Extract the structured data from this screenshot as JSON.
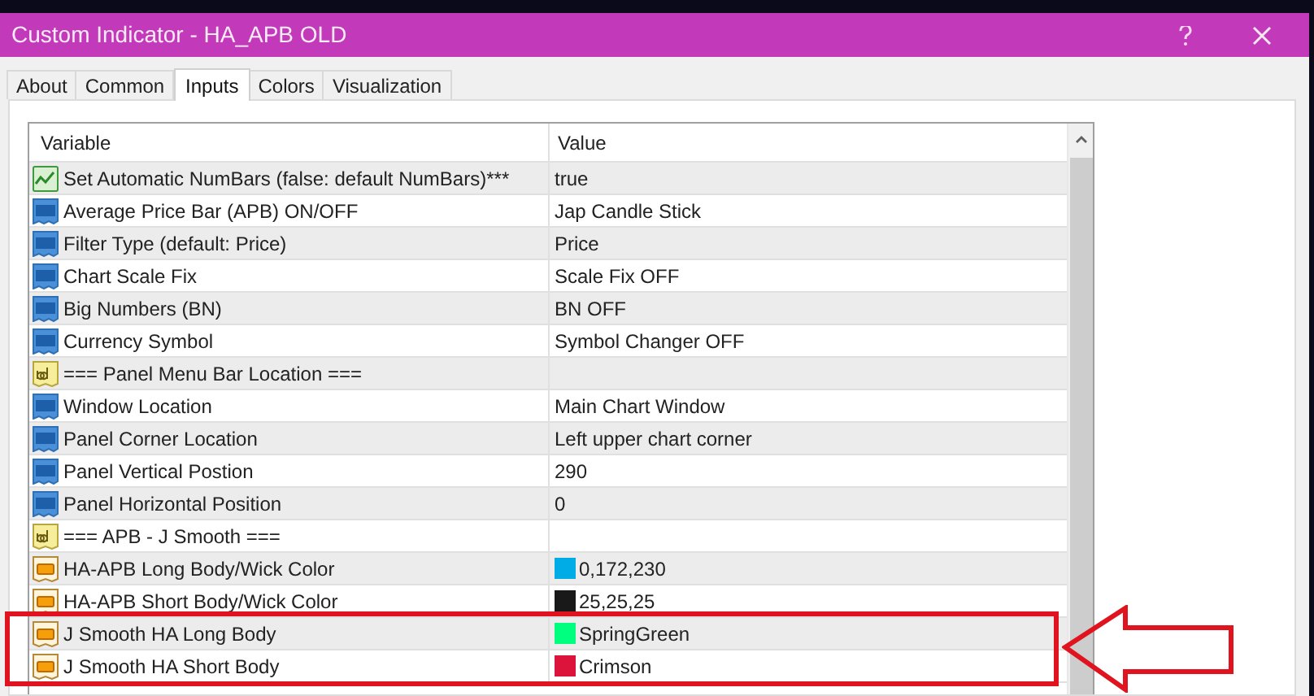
{
  "window": {
    "title": "Custom Indicator - HA_APB OLD"
  },
  "tabs": [
    {
      "label": "About",
      "selected": false
    },
    {
      "label": "Common",
      "selected": false
    },
    {
      "label": "Inputs",
      "selected": true
    },
    {
      "label": "Colors",
      "selected": false
    },
    {
      "label": "Visualization",
      "selected": false
    }
  ],
  "table": {
    "columns": [
      "Variable",
      "Value"
    ],
    "rows": [
      {
        "kind": "bool",
        "variable": "Set Automatic NumBars (false: default NumBars)***",
        "value": "true",
        "highlighted": false
      },
      {
        "kind": "number",
        "variable": "Average Price Bar (APB) ON/OFF",
        "value": "Jap Candle Stick",
        "highlighted": false
      },
      {
        "kind": "number",
        "variable": "Filter Type (default: Price)",
        "value": "Price",
        "highlighted": false
      },
      {
        "kind": "number",
        "variable": "Chart Scale Fix",
        "value": "Scale Fix OFF",
        "highlighted": false
      },
      {
        "kind": "number",
        "variable": "Big Numbers (BN)",
        "value": "BN OFF",
        "highlighted": false
      },
      {
        "kind": "number",
        "variable": "Currency Symbol",
        "value": "Symbol Changer OFF",
        "highlighted": false
      },
      {
        "kind": "string",
        "variable": "=== Panel Menu Bar Location ===",
        "highlighted": false
      },
      {
        "kind": "number",
        "variable": "Window Location",
        "value": "Main Chart Window",
        "highlighted": false
      },
      {
        "kind": "number",
        "variable": "Panel Corner Location",
        "value": "Left upper chart corner",
        "highlighted": false
      },
      {
        "kind": "number",
        "variable": "Panel Vertical Postion",
        "value": "290",
        "highlighted": false
      },
      {
        "kind": "number",
        "variable": "Panel Horizontal Position",
        "value": "0",
        "highlighted": false
      },
      {
        "kind": "string",
        "variable": "=== APB - J Smooth  ===",
        "highlighted": false
      },
      {
        "kind": "color",
        "variable": "HA-APB Long Body/Wick Color",
        "value": "0,172,230",
        "color": "#00acE6",
        "highlighted": false
      },
      {
        "kind": "color",
        "variable": "HA-APB Short Body/Wick Color",
        "value": "25,25,25",
        "color": "#191919",
        "highlighted": false
      },
      {
        "kind": "color",
        "variable": "J Smooth HA Long Body",
        "value": "SpringGreen",
        "color": "#00ff7f",
        "highlighted": true
      },
      {
        "kind": "color",
        "variable": "J Smooth HA Short Body",
        "value": "Crimson",
        "color": "#dc143c",
        "highlighted": true
      }
    ]
  }
}
